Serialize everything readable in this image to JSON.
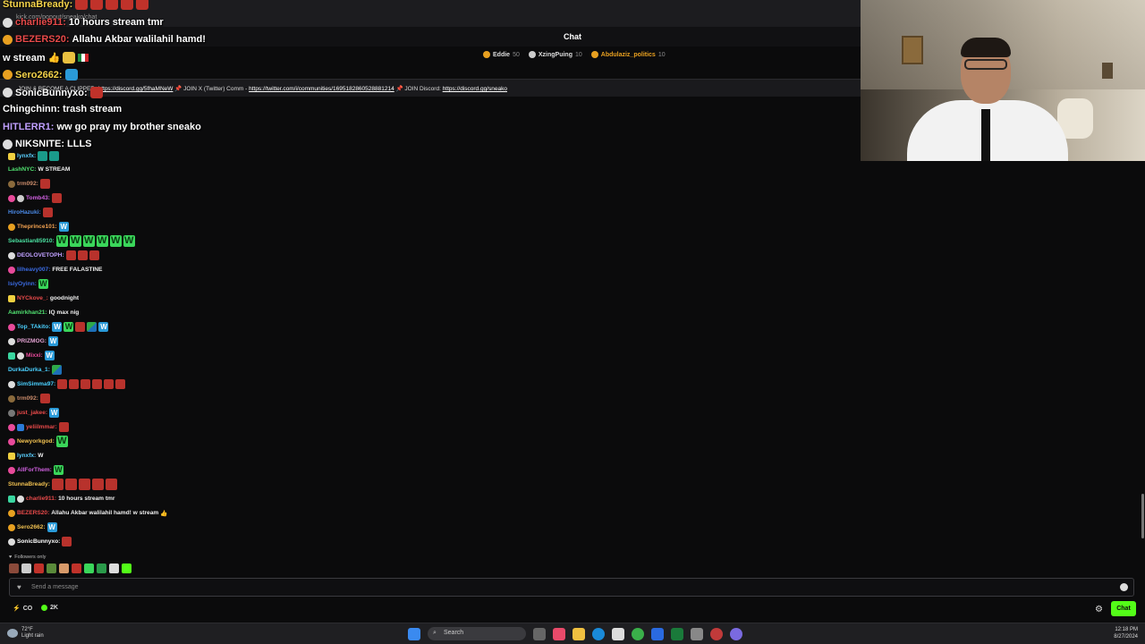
{
  "browser": {
    "url": "kick.com/popout/sneako/chat"
  },
  "chat_header": {
    "title": "Chat"
  },
  "gifters": [
    {
      "name": "Eddie",
      "count": "50"
    },
    {
      "name": "XzingPuing",
      "count": "10"
    },
    {
      "name": "Abdulaziz_politics",
      "count": "10"
    }
  ],
  "pinned": {
    "text1": "JOIN & BECOME A CLIPPER:",
    "link1": "https://discord.gg/5fhaMNeW",
    "text2": "JOIN X (Twitter) Comm -",
    "link2": "https://twitter.com/i/communities/1695182860528881214",
    "text3": "JOIN Discord:",
    "link3": "https://discord.gg/sneako"
  },
  "overlay": [
    {
      "user": "StunnaBready:",
      "text": ""
    },
    {
      "user": "charlie911:",
      "text": "10 hours stream tmr"
    },
    {
      "user": "BEZERS20:",
      "text": "Allahu Akbar walilahil hamd!"
    },
    {
      "user": "",
      "text": "w stream"
    },
    {
      "user": "Sero2662:",
      "text": ""
    },
    {
      "user": "SonicBunnyxo:",
      "text": ""
    },
    {
      "user": "Chingchinn:",
      "text": "trash stream"
    },
    {
      "user": "HITLERR1:",
      "text": "ww go pray my brother sneako"
    },
    {
      "user": "NIKSNITE:",
      "text": "LLLS"
    }
  ],
  "messages": [
    {
      "user": "lynxfx:",
      "color": "#5ad0ff",
      "text": ""
    },
    {
      "user": "LashNYC:",
      "color": "#50e070",
      "text": "W STREAM"
    },
    {
      "user": "trm092:",
      "color": "#c88a6a",
      "text": ""
    },
    {
      "user": "Tomb43:",
      "color": "#d060e0",
      "text": ""
    },
    {
      "user": "HiroHazuki:",
      "color": "#4a8ae8",
      "text": ""
    },
    {
      "user": "Theprince101:",
      "color": "#f0a050",
      "text": ""
    },
    {
      "user": "Sebastian85910:",
      "color": "#4ae0a0",
      "text": ""
    },
    {
      "user": "DEOLOVETOPH:",
      "color": "#c0a0ff",
      "text": ""
    },
    {
      "user": "lilheavy007:",
      "color": "#3a6ae0",
      "text": "FREE FALASTINE"
    },
    {
      "user": "IsiyOyinn:",
      "color": "#3a6ae0",
      "text": ""
    },
    {
      "user": "NYCkove_:",
      "color": "#e84a4a",
      "text": "goodnight"
    },
    {
      "user": "Aamirkhan21:",
      "color": "#50e070",
      "text": "IQ max nig"
    },
    {
      "user": "Top_TAkito:",
      "color": "#4ad0ff",
      "text": ""
    },
    {
      "user": "PRIZMOG:",
      "color": "#e0a0d0",
      "text": ""
    },
    {
      "user": "Mixxi:",
      "color": "#e84a9a",
      "text": ""
    },
    {
      "user": "DurkaDurka_1:",
      "color": "#4ad0ff",
      "text": ""
    },
    {
      "user": "SimSimma97:",
      "color": "#4ad0ff",
      "text": ""
    },
    {
      "user": "trm092:",
      "color": "#c88a6a",
      "text": ""
    },
    {
      "user": "just_jakee:",
      "color": "#e84a4a",
      "text": ""
    },
    {
      "user": "yeliilmmar:",
      "color": "#e84a4a",
      "text": ""
    },
    {
      "user": "Newyorkgod:",
      "color": "#f0c050",
      "text": ""
    },
    {
      "user": "lynxfx:",
      "color": "#5ad0ff",
      "text": "W"
    },
    {
      "user": "AllForThem:",
      "color": "#d060e0",
      "text": ""
    },
    {
      "user": "StunnaBready:",
      "color": "#f0c050",
      "text": ""
    },
    {
      "user": "charlie911:",
      "color": "#e84a4a",
      "text": "10 hours stream tmr"
    },
    {
      "user": "BEZERS20:",
      "color": "#e84a4a",
      "text": "Allahu Akbar walilahil hamd! w stream"
    },
    {
      "user": "Sero2662:",
      "color": "#f0c050",
      "text": ""
    },
    {
      "user": "SonicBunnyxo:",
      "color": "#ffffff",
      "text": ""
    }
  ],
  "followers_only": "Followers only",
  "input": {
    "placeholder": "Send a message"
  },
  "stats": {
    "points": "CO",
    "viewers": "2K"
  },
  "chat_button": "Chat",
  "taskbar": {
    "weather_temp": "72°F",
    "weather_desc": "Light rain",
    "search": "Search",
    "time": "12:18 PM",
    "date": "8/27/2024"
  }
}
